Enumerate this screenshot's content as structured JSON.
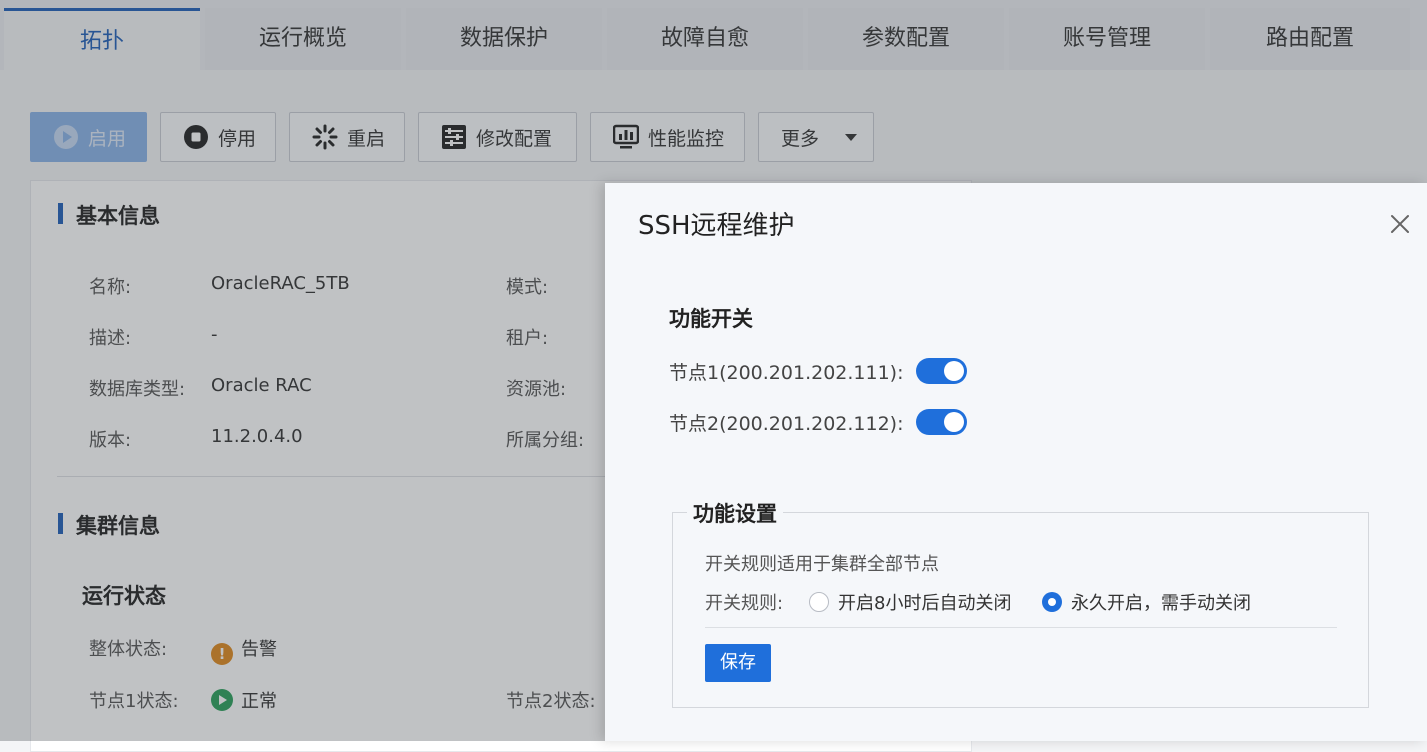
{
  "tabs": [
    {
      "label": "拓扑"
    },
    {
      "label": "运行概览"
    },
    {
      "label": "数据保护"
    },
    {
      "label": "故障自愈"
    },
    {
      "label": "参数配置"
    },
    {
      "label": "账号管理"
    },
    {
      "label": "路由配置"
    }
  ],
  "toolbar": {
    "start": "启用",
    "stop": "停用",
    "restart": "重启",
    "modify": "修改配置",
    "monitor": "性能监控",
    "more": "更多"
  },
  "basic": {
    "title": "基本信息",
    "name_label": "名称:",
    "name_value": "OracleRAC_5TB",
    "desc_label": "描述:",
    "desc_value": "-",
    "dbtype_label": "数据库类型:",
    "dbtype_value": "Oracle RAC",
    "version_label": "版本:",
    "version_value": "11.2.0.4.0",
    "mode_label": "模式:",
    "tenant_label": "租户:",
    "pool_label": "资源池:",
    "group_label": "所属分组:"
  },
  "cluster": {
    "title": "集群信息",
    "run_title": "运行状态",
    "overall_label": "整体状态:",
    "overall_value": "告警",
    "node1_label": "节点1状态:",
    "node1_value": "正常",
    "node2_label": "节点2状态:"
  },
  "dialog": {
    "title": "SSH远程维护",
    "switch_section": "功能开关",
    "node1": "节点1(200.201.202.111):",
    "node2": "节点2(200.201.202.112):",
    "node1_on": true,
    "node2_on": true,
    "settings_section": "功能设置",
    "note": "开关规则适用于集群全部节点",
    "rule_label": "开关规则:",
    "option1": "开启8小时后自动关闭",
    "option2": "永久开启，需手动关闭",
    "selected_option": 2,
    "save": "保存"
  },
  "colors": {
    "accent": "#1f6fdb",
    "tab_active": "#1f5fb8",
    "warning": "#e08a1e",
    "ok": "#2aa05a"
  }
}
